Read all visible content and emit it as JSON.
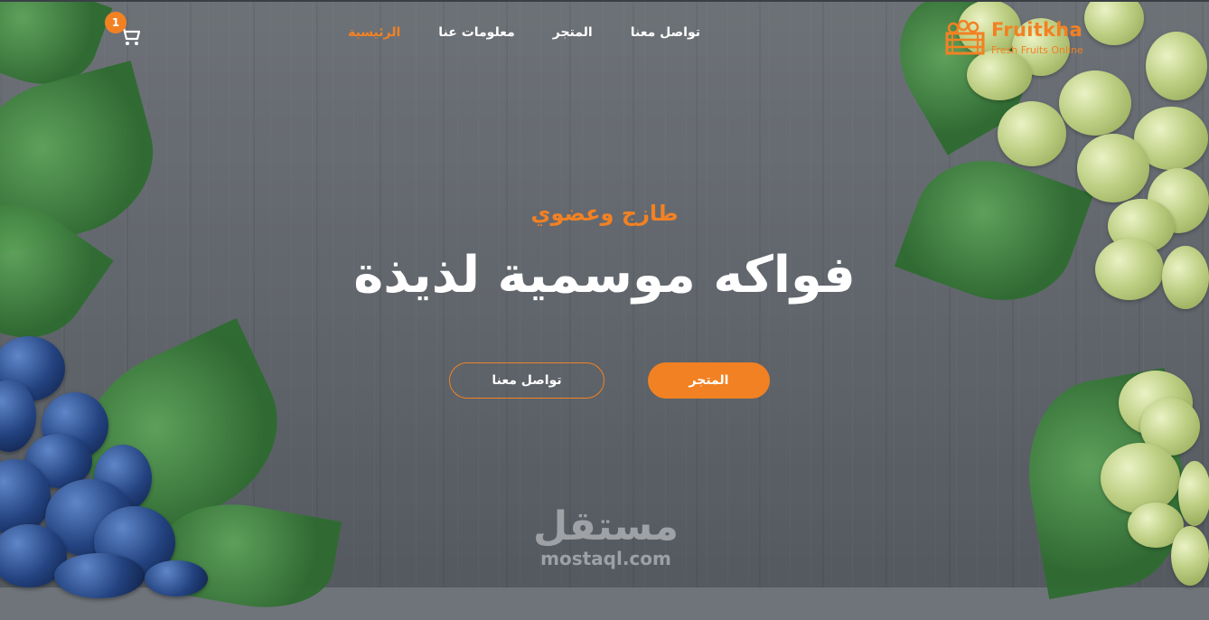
{
  "brand": {
    "name": "Fruitkha",
    "tagline": "Fresh Fruits Online",
    "accent_color": "#f28123",
    "logo_icon": "fruit-crate-icon"
  },
  "nav": {
    "items": [
      {
        "label": "الرئيسية",
        "active": true
      },
      {
        "label": "معلومات عنا",
        "active": false
      },
      {
        "label": "المتجر",
        "active": false
      },
      {
        "label": "تواصل معنا",
        "active": false
      }
    ]
  },
  "cart": {
    "icon": "cart-icon",
    "count": "1"
  },
  "hero": {
    "subtitle": "طازج وعضوي",
    "title": "فواكه موسمية لذيذة",
    "primary_button": "المتجر",
    "secondary_button": "تواصل معنا"
  },
  "watermark": {
    "arabic": "مستقل",
    "latin": "mostaql.com"
  }
}
